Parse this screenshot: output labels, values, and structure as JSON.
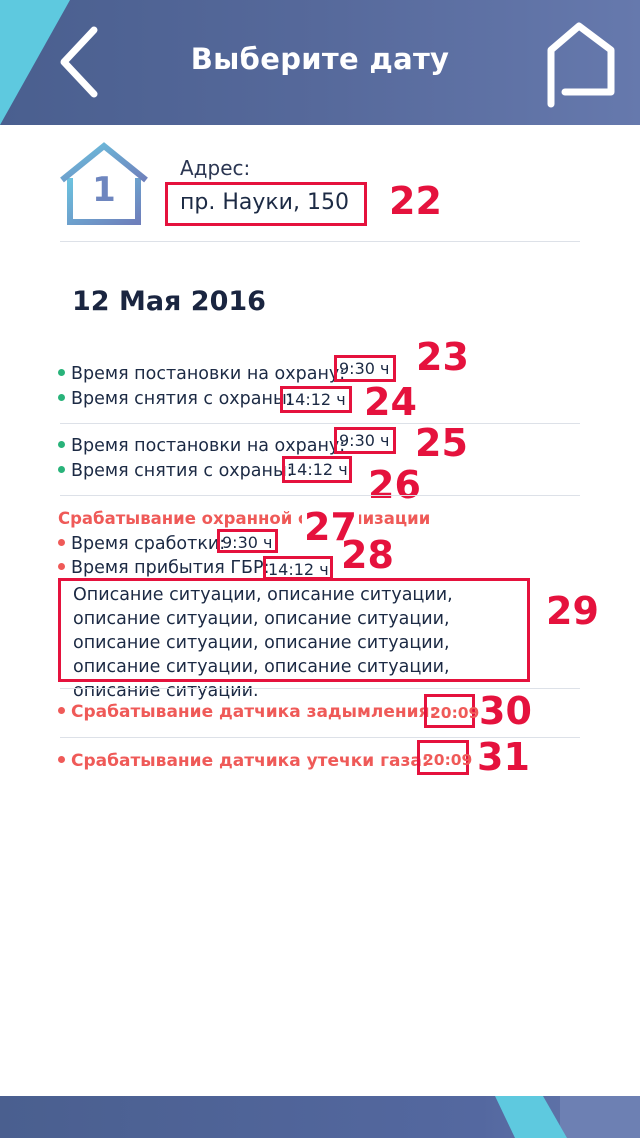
{
  "header": {
    "title": "Выберите дату",
    "back_icon": "chevron-left-icon",
    "flag_icon": "flag-icon"
  },
  "address": {
    "house_number": "1",
    "label": "Адрес:",
    "value": "пр. Науки, 150"
  },
  "date": "12 Мая 2016",
  "sessions": [
    {
      "arm_label": "Время постановки на охрану:",
      "arm_time": "9:30 ч",
      "disarm_label": "Время снятия с охраны:",
      "disarm_time": "14:12 ч"
    },
    {
      "arm_label": "Время постановки на охрану:",
      "arm_time": "9:30 ч",
      "disarm_label": "Время снятия с охраны:",
      "disarm_time": "14:12 ч"
    }
  ],
  "alarm": {
    "title": "Срабатывание охранной сигнализации",
    "trigger_label": "Время сработки:",
    "trigger_time": "9:30 ч",
    "arrival_label": "Время прибытия ГБР:",
    "arrival_time": "14:12 ч",
    "description": "Описание ситуации, описание ситуации, описание ситуации, описание ситуации, описание ситуации, описание ситуации, описание ситуации, описание ситуации, описание ситуации."
  },
  "sensors": [
    {
      "label": "Срабатывание датчика задымления:",
      "time": "20:09"
    },
    {
      "label": "Срабатывание датчика утечки газа:",
      "time": "20:09"
    }
  ],
  "annotations": [
    "22",
    "23",
    "24",
    "25",
    "26",
    "27",
    "28",
    "29",
    "30",
    "31"
  ],
  "colors": {
    "header": "#56699b",
    "accent": "#5ec9df",
    "annotation": "#e5123d",
    "alarm": "#ef5a58",
    "ok": "#29b37a"
  }
}
